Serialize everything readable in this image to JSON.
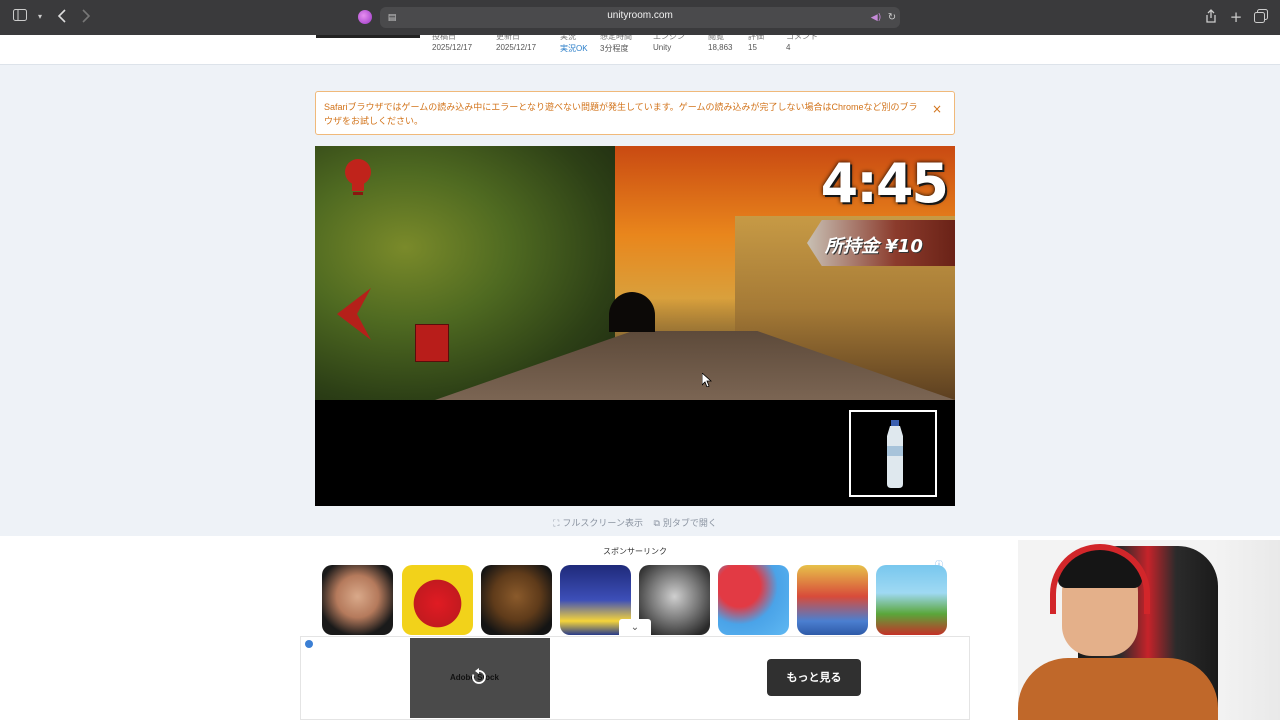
{
  "browser": {
    "url": "unityroom.com",
    "icons": [
      "sidebar-icon",
      "chevron-down-icon",
      "back-icon",
      "forward-icon",
      "reader-icon",
      "mute-icon",
      "reload-icon",
      "share-icon",
      "new-tab-icon",
      "tabs-icon"
    ]
  },
  "game_meta": {
    "items": [
      {
        "label": "投稿日",
        "value": "2025/12/17"
      },
      {
        "label": "更新日",
        "value": "2025/12/17"
      },
      {
        "label": "実況",
        "value": "実況OK"
      },
      {
        "label": "想定時間",
        "value": "3分程度"
      },
      {
        "label": "エンジン",
        "value": "Unity"
      },
      {
        "label": "閲覧",
        "value": "18,863"
      },
      {
        "label": "評価",
        "value": "15"
      },
      {
        "label": "コメント",
        "value": "4"
      }
    ]
  },
  "notice": {
    "text": "Safariブラウザではゲームの読み込み中にエラーとなり遊べない問題が発生しています。ゲームの読み込みが完了しない場合はChromeなど別のブラウザをお試しください。",
    "close": "×"
  },
  "game": {
    "timer": "4:45",
    "money": "所持金 ¥10",
    "inventory_item": "water-bottle"
  },
  "actions": {
    "fullscreen": "フルスクリーン表示",
    "new_tab": "別タブで開く"
  },
  "sponsor": {
    "label": "スポンサーリンク",
    "thumbnails": [
      "baby-doll-game",
      "impostor-game",
      "bear-animatronic-game",
      "runner-minion-game",
      "granny-horror-game",
      "crowd-run-game",
      "subway-runner-game",
      "hill-climb-2-game"
    ]
  },
  "bottom_ad": {
    "brand": "Adobe Stock",
    "cta": "もっと見る",
    "collapse": "⌄"
  },
  "colors": {
    "notice_text": "#d2731a",
    "notice_border": "#f0b97a",
    "link": "#2a7ec9",
    "page_bg": "#eef2f7"
  }
}
